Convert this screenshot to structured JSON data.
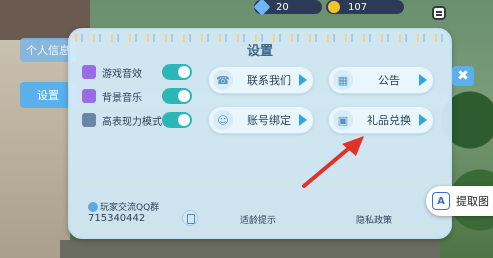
{
  "hud": {
    "gems": "20",
    "coins": "107"
  },
  "tabs": [
    {
      "label": "个人信息"
    },
    {
      "label": "设置"
    }
  ],
  "title": "设置",
  "toggles": [
    {
      "label": "游戏音效",
      "on": true
    },
    {
      "label": "背景音乐",
      "on": true
    },
    {
      "label": "高表现力模式",
      "on": true
    }
  ],
  "buttons": [
    {
      "label": "联系我们",
      "icon": "headset-icon"
    },
    {
      "label": "公告",
      "icon": "bulletin-icon"
    },
    {
      "label": "账号绑定",
      "icon": "account-icon"
    },
    {
      "label": "礼品兑换",
      "icon": "gift-icon"
    }
  ],
  "qq": {
    "label": "玩家交流QQ群",
    "number": "715340442"
  },
  "links": {
    "tips": "适龄提示",
    "privacy": "隐私政策"
  },
  "close": "✖",
  "extract": {
    "label": "提取图",
    "icon_text": "A"
  },
  "colors": {
    "accent": "#5ab0ea",
    "toggle_on": "#2bb7b8",
    "arrow": "#e0322b"
  }
}
